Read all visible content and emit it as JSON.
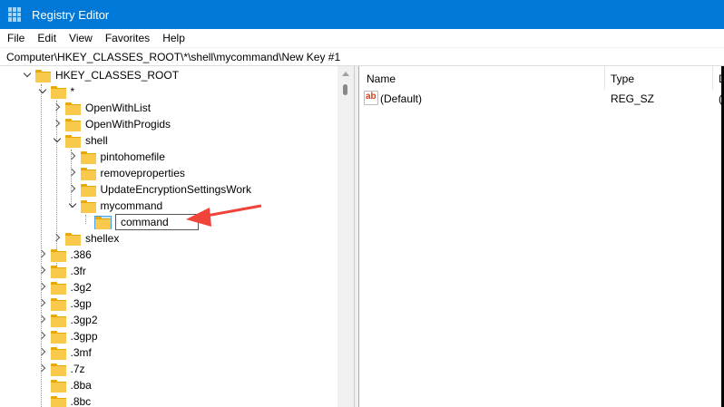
{
  "window": {
    "title": "Registry Editor"
  },
  "menu": [
    "File",
    "Edit",
    "View",
    "Favorites",
    "Help"
  ],
  "address": "Computer\\HKEY_CLASSES_ROOT\\*\\shell\\mycommand\\New Key #1",
  "tree": [
    {
      "label": "HKEY_CLASSES_ROOT",
      "level": 0,
      "state": "expanded"
    },
    {
      "label": "*",
      "level": 1,
      "state": "expanded"
    },
    {
      "label": "OpenWithList",
      "level": 2,
      "state": "collapsed"
    },
    {
      "label": "OpenWithProgids",
      "level": 2,
      "state": "collapsed"
    },
    {
      "label": "shell",
      "level": 2,
      "state": "expanded"
    },
    {
      "label": "pintohomefile",
      "level": 3,
      "state": "collapsed"
    },
    {
      "label": "removeproperties",
      "level": 3,
      "state": "collapsed"
    },
    {
      "label": "UpdateEncryptionSettingsWork",
      "level": 3,
      "state": "collapsed"
    },
    {
      "label": "mycommand",
      "level": 3,
      "state": "expanded"
    },
    {
      "label": "command",
      "level": 4,
      "state": "editing"
    },
    {
      "label": "shellex",
      "level": 2,
      "state": "collapsed"
    },
    {
      "label": ".386",
      "level": 1,
      "state": "collapsed"
    },
    {
      "label": ".3fr",
      "level": 1,
      "state": "collapsed"
    },
    {
      "label": ".3g2",
      "level": 1,
      "state": "collapsed"
    },
    {
      "label": ".3gp",
      "level": 1,
      "state": "collapsed"
    },
    {
      "label": ".3gp2",
      "level": 1,
      "state": "collapsed"
    },
    {
      "label": ".3gpp",
      "level": 1,
      "state": "collapsed"
    },
    {
      "label": ".3mf",
      "level": 1,
      "state": "collapsed"
    },
    {
      "label": ".7z",
      "level": 1,
      "state": "collapsed"
    },
    {
      "label": ".8ba",
      "level": 1,
      "state": "leaf"
    },
    {
      "label": ".8bc",
      "level": 1,
      "state": "leaf"
    }
  ],
  "values": {
    "columns": [
      "Name",
      "Type",
      "D"
    ],
    "rows": [
      {
        "icon": "ab",
        "name": "(Default)",
        "type": "REG_SZ",
        "data": "("
      }
    ]
  },
  "colors": {
    "titlebar": "#0078d7",
    "arrow": "#f0433a"
  }
}
